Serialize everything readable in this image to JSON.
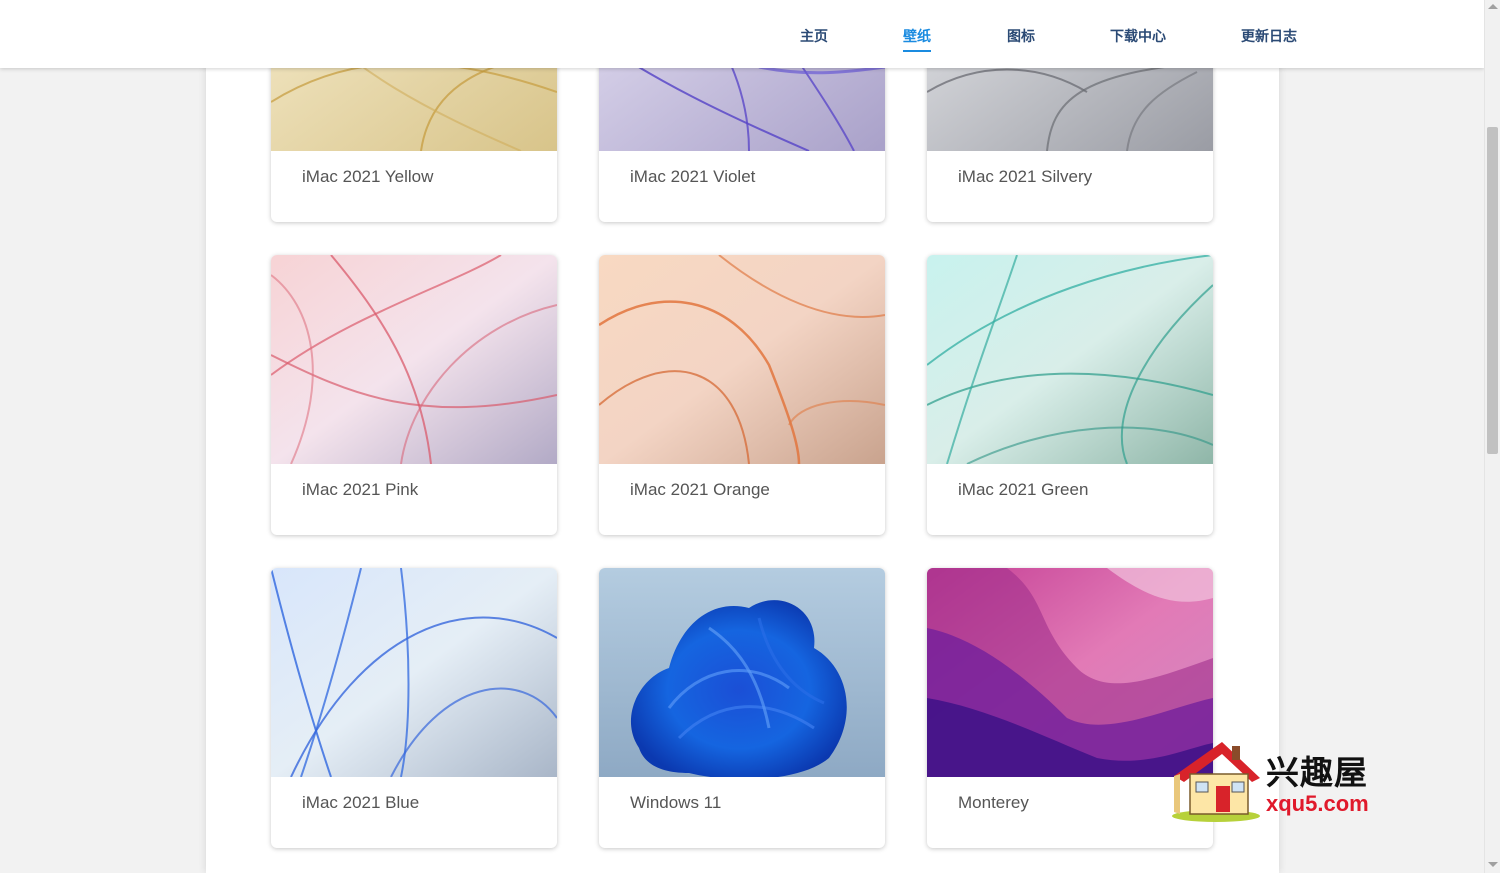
{
  "nav": {
    "items": [
      {
        "label": "主页",
        "active": false
      },
      {
        "label": "壁纸",
        "active": true
      },
      {
        "label": "图标",
        "active": false
      },
      {
        "label": "下载中心",
        "active": false
      },
      {
        "label": "更新日志",
        "active": false
      }
    ]
  },
  "wallpapers": [
    {
      "title": "iMac 2021 Yellow"
    },
    {
      "title": "iMac 2021 Violet"
    },
    {
      "title": "iMac 2021 Silvery"
    },
    {
      "title": "iMac 2021 Pink"
    },
    {
      "title": "iMac 2021 Orange"
    },
    {
      "title": "iMac 2021 Green"
    },
    {
      "title": "iMac 2021 Blue"
    },
    {
      "title": "Windows 11"
    },
    {
      "title": "Monterey"
    }
  ],
  "watermark": {
    "name": "兴趣屋",
    "domain": "xqu5.com"
  },
  "colors": {
    "nav_text": "#2b4a75",
    "nav_active": "#1a8be0",
    "card_title": "#555555",
    "watermark_red": "#e0192b"
  }
}
